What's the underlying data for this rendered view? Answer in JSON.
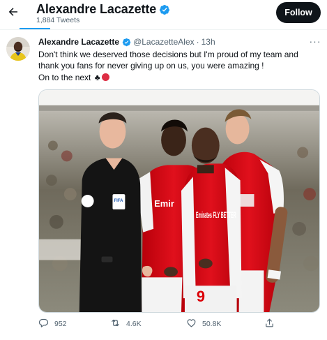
{
  "header": {
    "title": "Alexandre Lacazette",
    "tweet_count": "1,884 Tweets",
    "follow_label": "Follow"
  },
  "tweet": {
    "name": "Alexandre Lacazette",
    "handle": "@LacazetteAlex",
    "separator": "·",
    "time": "13h",
    "text_line1": "Don't think we deserved those decisions but I'm proud of my team and",
    "text_line2": "thank you fans for never giving up on us, you were amazing !",
    "text_line3": "On to the next",
    "emoji_club": "♣",
    "emoji_circle": "red-circle"
  },
  "photo": {
    "referee_badge": "FIFA",
    "shirt_sponsor": "Emirates FLY BETTER",
    "shirt_number": "9"
  },
  "actions": {
    "replies": "952",
    "retweets": "4.6K",
    "likes": "50.8K"
  },
  "icons": {
    "back": "arrow-left-icon",
    "verified": "verified-badge-icon",
    "more": "more-dots-icon",
    "reply": "reply-icon",
    "retweet": "retweet-icon",
    "like": "heart-icon",
    "share": "share-icon"
  },
  "colors": {
    "accent": "#1d9bf0",
    "text": "#0f1419",
    "muted": "#536471",
    "follow_bg": "#0f1419",
    "arsenal_red": "#db0007"
  }
}
